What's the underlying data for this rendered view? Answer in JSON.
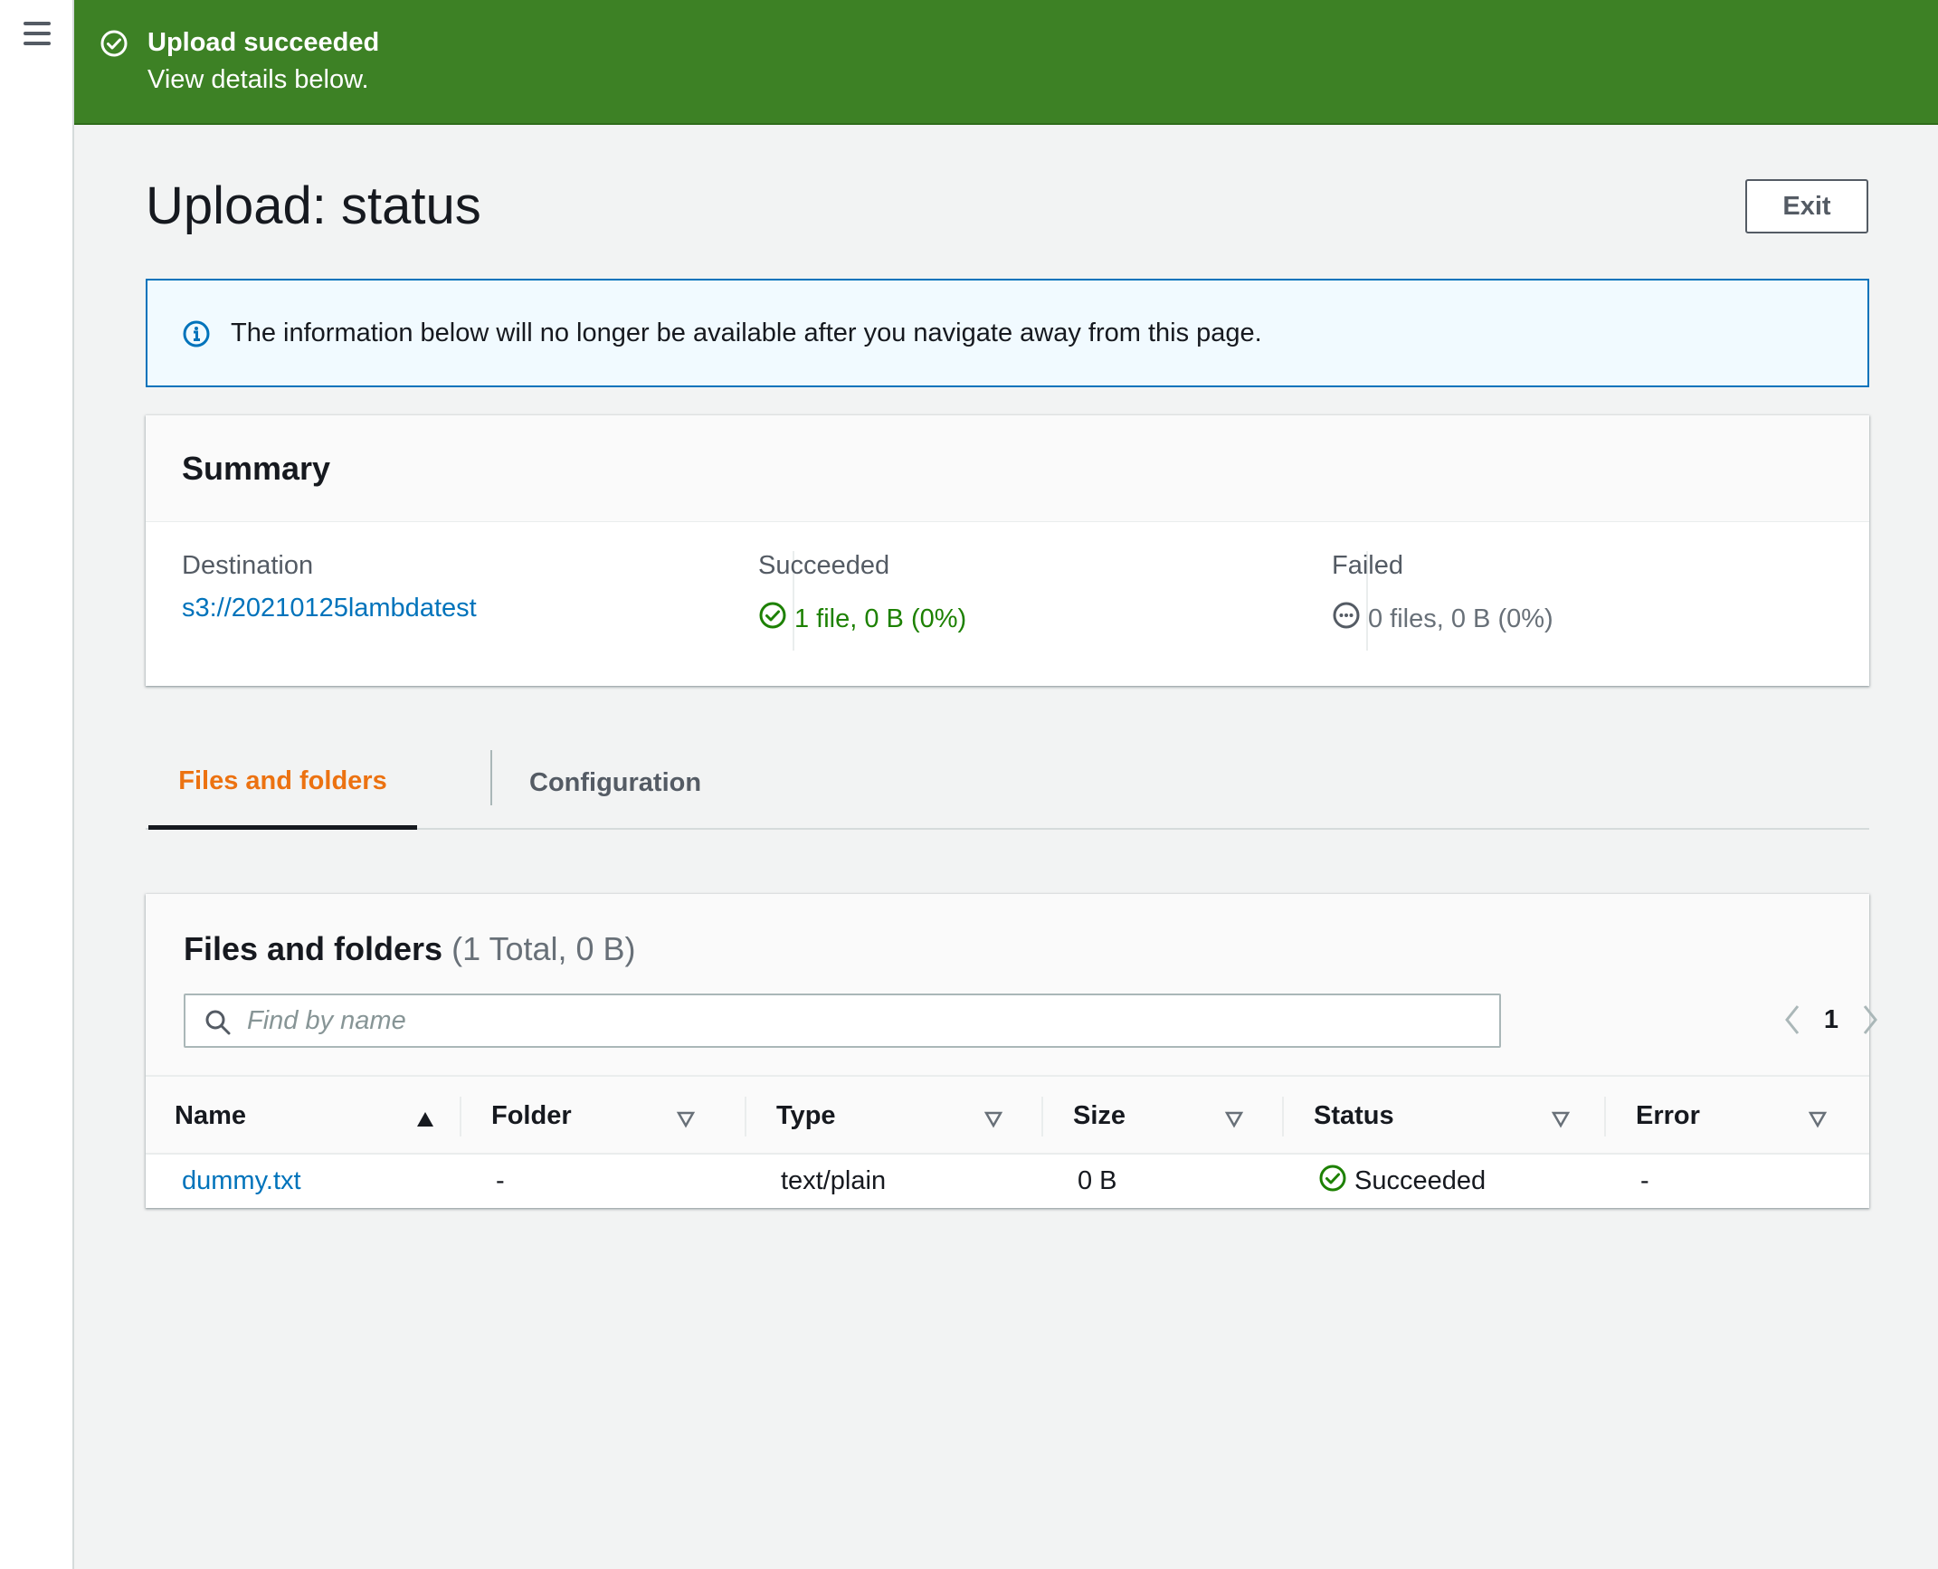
{
  "flash": {
    "title": "Upload succeeded",
    "description": "View details below."
  },
  "page": {
    "title": "Upload: status",
    "exit_label": "Exit"
  },
  "info_alert": {
    "text": "The information below will no longer be available after you navigate away from this page."
  },
  "summary": {
    "title": "Summary",
    "destination_label": "Destination",
    "destination_value": "s3://20210125lambdatest",
    "succeeded_label": "Succeeded",
    "succeeded_value": "1 file, 0 B (0%)",
    "failed_label": "Failed",
    "failed_value": "0 files, 0 B (0%)"
  },
  "tabs": [
    {
      "label": "Files and folders",
      "active": true
    },
    {
      "label": "Configuration",
      "active": false
    }
  ],
  "files": {
    "title": "Files and folders",
    "count": "(1 Total, 0 B)",
    "search_placeholder": "Find by name",
    "page": "1",
    "columns": [
      "Name",
      "Folder",
      "Type",
      "Size",
      "Status",
      "Error"
    ],
    "rows": [
      {
        "name": "dummy.txt",
        "folder": "-",
        "type": "text/plain",
        "size": "0 B",
        "status": "Succeeded",
        "error": "-"
      }
    ]
  },
  "colors": {
    "success_banner": "#3d8125",
    "success_text": "#1d8102",
    "link": "#0073bb",
    "active_tab": "#ec7211",
    "info_border": "#0073bb"
  }
}
